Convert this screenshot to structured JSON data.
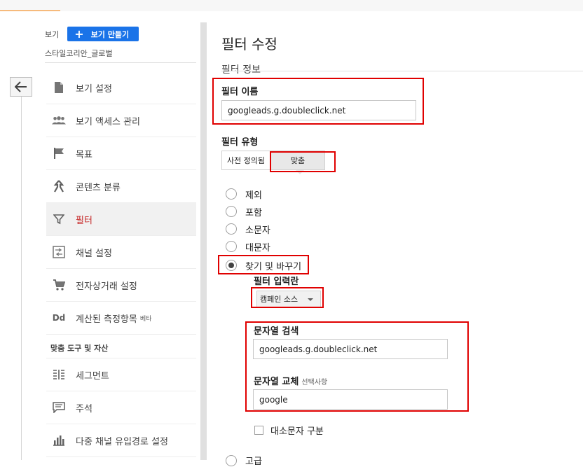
{
  "sidebar": {
    "view_label": "보기",
    "create_view_button": "보기 만들기",
    "view_name": "스타일코리안_글로벌",
    "items": [
      {
        "label": "보기 설정",
        "icon": "document-icon"
      },
      {
        "label": "보기 액세스 관리",
        "icon": "people-icon"
      },
      {
        "label": "목표",
        "icon": "flag-icon"
      },
      {
        "label": "콘텐츠 분류",
        "icon": "grouping-icon"
      },
      {
        "label": "필터",
        "icon": "filter-icon",
        "active": true
      },
      {
        "label": "채널 설정",
        "icon": "channel-settings-icon"
      },
      {
        "label": "전자상거래 설정",
        "icon": "cart-icon"
      },
      {
        "label": "계산된 측정항목",
        "icon": "dd-icon",
        "badge": "베타"
      }
    ],
    "section_title": "맞춤 도구 및 자산",
    "tool_items": [
      {
        "label": "세그먼트",
        "icon": "segment-icon"
      },
      {
        "label": "주석",
        "icon": "annotation-icon"
      },
      {
        "label": "다중 채널 유입경로 설정",
        "icon": "bar-chart-icon"
      }
    ]
  },
  "main": {
    "title": "필터 수정",
    "section_label": "필터 정보",
    "filter_name_label": "필터 이름",
    "filter_name_value": "googleads.g.doubleclick.net",
    "filter_type_label": "필터 유형",
    "filter_type_predefined": "사전 정의됨",
    "filter_type_custom": "맞춤",
    "radio_options": [
      {
        "label": "제외",
        "selected": false
      },
      {
        "label": "포함",
        "selected": false
      },
      {
        "label": "소문자",
        "selected": false
      },
      {
        "label": "대문자",
        "selected": false
      },
      {
        "label": "찾기 및 바꾸기",
        "selected": true
      }
    ],
    "filter_field_label": "필터 입력란",
    "filter_field_value": "캠페인 소스",
    "search_string_label": "문자열 검색",
    "search_string_value": "googleads.g.doubleclick.net",
    "replace_string_label": "문자열 교체",
    "replace_optional_note": "선택사항",
    "replace_string_value": "google",
    "case_sensitive_label": "대소문자 구분",
    "cutoff_radio_label": "고급"
  },
  "colors": {
    "accent_orange": "#f57c00",
    "button_blue": "#1a73e8",
    "annotation_red": "#e00000",
    "active_nav_text": "#c62828"
  }
}
